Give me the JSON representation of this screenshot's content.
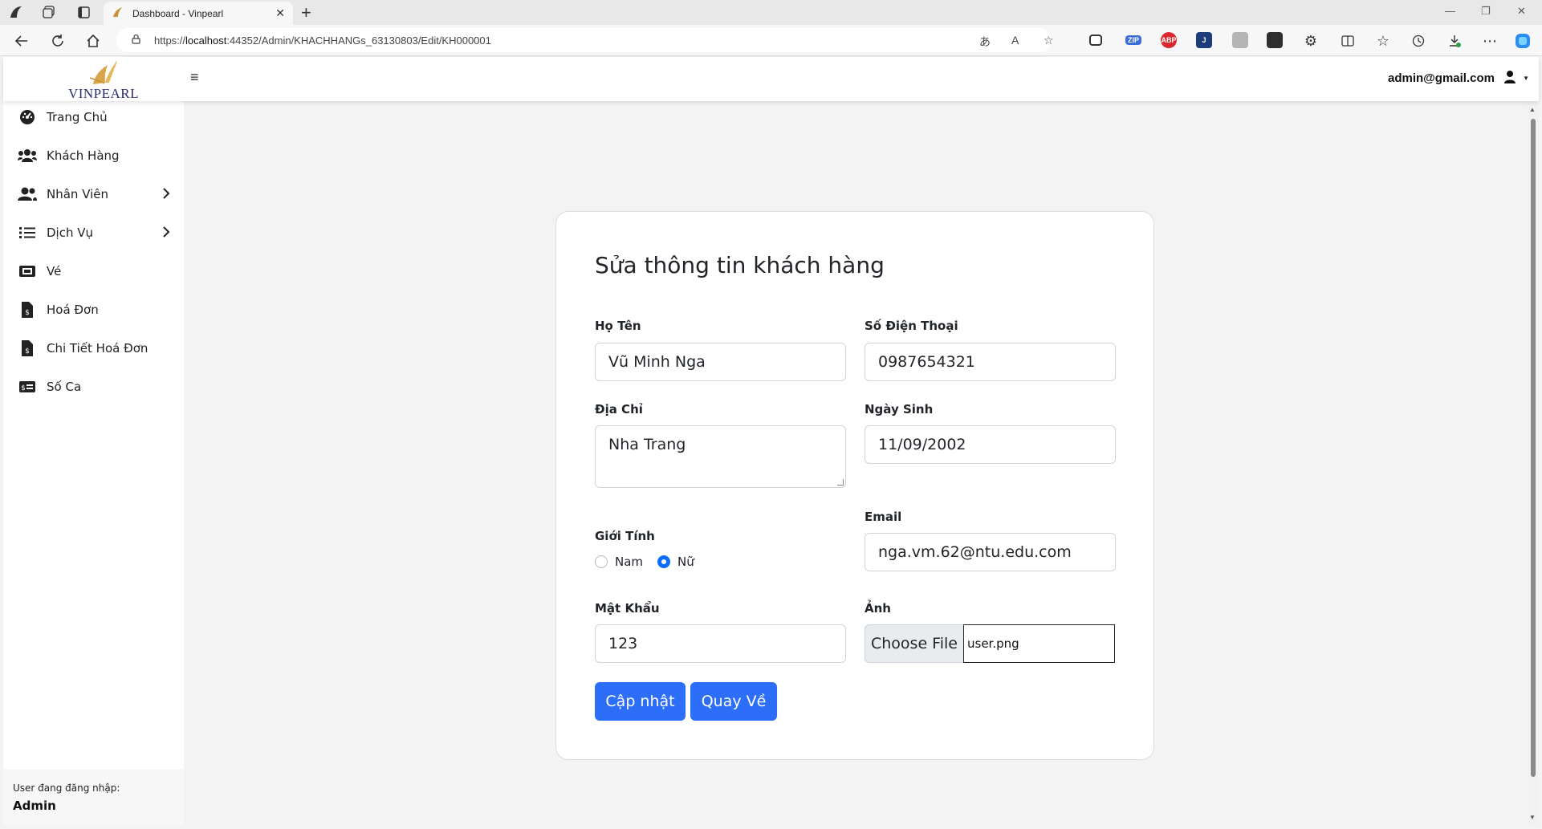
{
  "browser": {
    "tab_title": "Dashboard - Vinpearl",
    "url_prefix": "https://",
    "url_host": "localhost",
    "url_rest": ":44352/Admin/KHACHHANGs_63130803/Edit/KH000001",
    "extensions": [
      "zip-extension",
      "adblock-plus",
      "j-extension",
      "image-extension",
      "terminal-extension"
    ]
  },
  "header": {
    "brand": "VINPEARL",
    "user_email": "admin@gmail.com"
  },
  "sidebar": {
    "items": [
      {
        "label": "Trang Chủ",
        "icon": "dashboard-icon"
      },
      {
        "label": "Khách Hàng",
        "icon": "users-icon"
      },
      {
        "label": "Nhân Viên",
        "icon": "user-group-icon"
      },
      {
        "label": "Dịch Vụ",
        "icon": "list-icon"
      },
      {
        "label": "Vé",
        "icon": "ticket-icon"
      },
      {
        "label": "Hoá Đơn",
        "icon": "invoice-icon"
      },
      {
        "label": "Chi Tiết Hoá Đơn",
        "icon": "invoice-detail-icon"
      },
      {
        "label": "Số Ca",
        "icon": "money-card-icon"
      }
    ],
    "footer_label": "User đang đăng nhập:",
    "footer_user": "Admin"
  },
  "form": {
    "title": "Sửa thông tin khách hàng",
    "name_label": "Họ Tên",
    "name_value": "Vũ Minh Nga",
    "phone_label": "Số Điện Thoại",
    "phone_value": "0987654321",
    "address_label": "Địa Chỉ",
    "address_value": "Nha Trang",
    "dob_label": "Ngày Sinh",
    "dob_value": "11/09/2002",
    "gender_label": "Giới Tính",
    "gender_options": [
      "Nam",
      "Nữ"
    ],
    "gender_selected": "Nữ",
    "email_label": "Email",
    "email_value": "nga.vm.62@ntu.edu.com",
    "password_label": "Mật Khẩu",
    "password_value": "123",
    "photo_label": "Ảnh",
    "file_button": "Choose File",
    "file_name": "user.png",
    "update_button": "Cập nhật",
    "back_button": "Quay Về"
  },
  "colors": {
    "primary": "#2d6ef8",
    "logo_gold": "#d8a548",
    "logo_navy": "#2a2e6e"
  }
}
